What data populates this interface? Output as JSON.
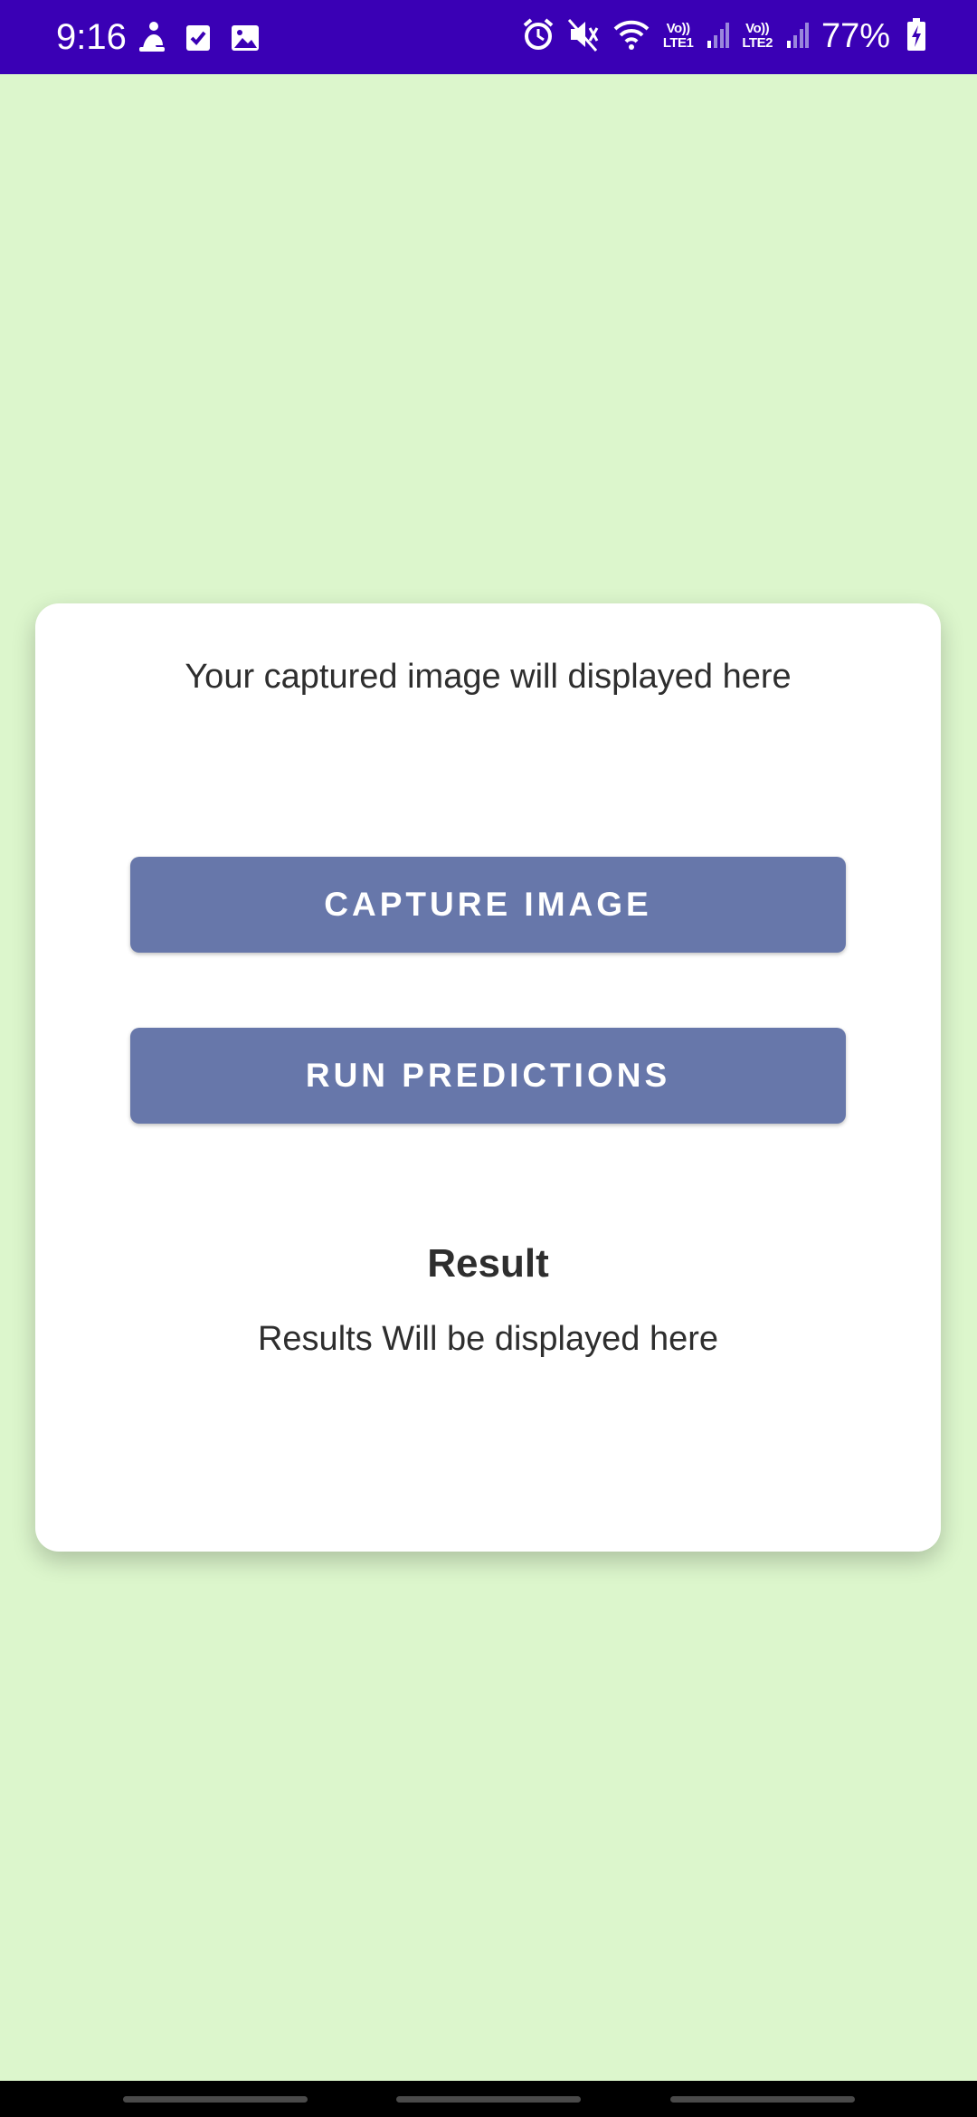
{
  "status_bar": {
    "time": "9:16",
    "battery_percent": "77%",
    "network": {
      "sim1_top": "Vo))",
      "sim1_bottom": "LTE1",
      "sim2_top": "Vo))",
      "sim2_bottom": "LTE2"
    },
    "icons": [
      "person-icon",
      "checkbox-icon",
      "image-icon",
      "alarm-icon",
      "mute-icon",
      "wifi-icon",
      "signal-icon",
      "battery-charging-icon"
    ]
  },
  "card": {
    "image_placeholder": "Your captured image will displayed here",
    "capture_button": "CAPTURE IMAGE",
    "run_button": "RUN PREDICTIONS",
    "result_title": "Result",
    "result_text": "Results Will be displayed here"
  },
  "colors": {
    "status_bar": "#3a00b5",
    "background": "#dcf6cc",
    "button": "#6777aa",
    "card": "#ffffff"
  }
}
